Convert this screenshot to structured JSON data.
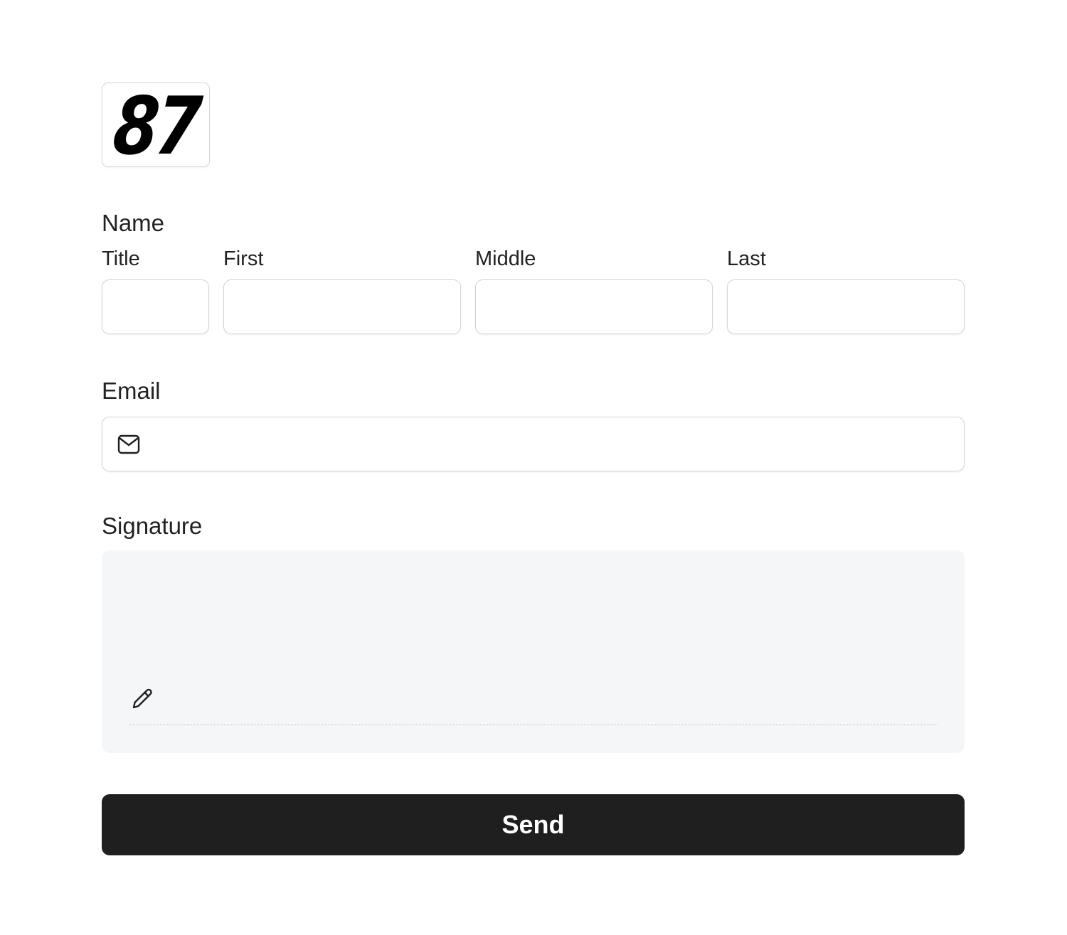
{
  "logo": {
    "text": "87"
  },
  "name": {
    "label": "Name",
    "fields": {
      "title": {
        "label": "Title",
        "value": ""
      },
      "first": {
        "label": "First",
        "value": ""
      },
      "middle": {
        "label": "Middle",
        "value": ""
      },
      "last": {
        "label": "Last",
        "value": ""
      }
    }
  },
  "email": {
    "label": "Email",
    "value": "",
    "icon": "envelope-icon"
  },
  "signature": {
    "label": "Signature",
    "icon": "pencil-icon"
  },
  "send_button": {
    "label": "Send"
  },
  "colors": {
    "button_bg": "#1f1f1f",
    "button_text": "#ffffff",
    "signature_bg": "#f5f6f8",
    "input_border": "#d0d4da"
  }
}
